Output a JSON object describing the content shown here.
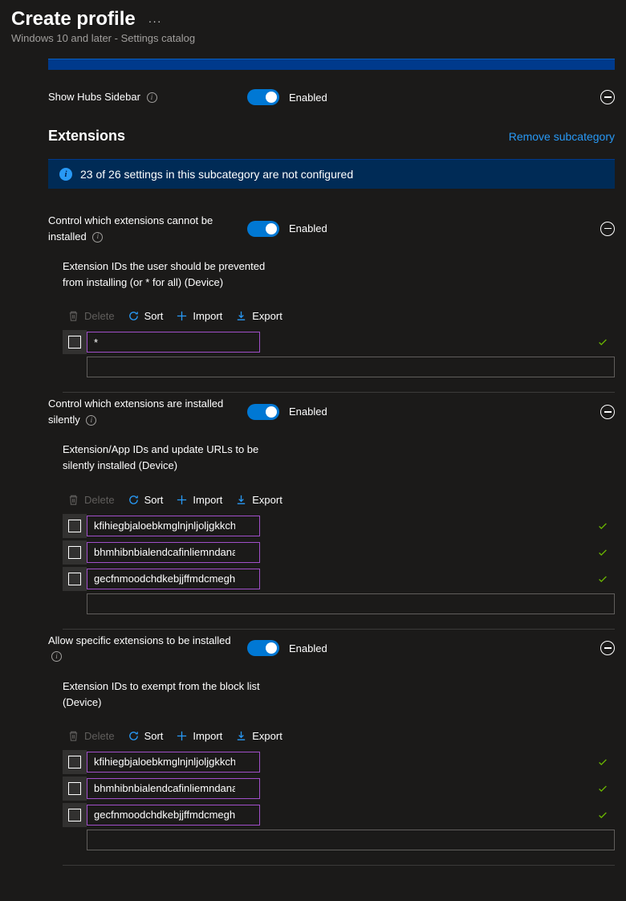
{
  "header": {
    "title": "Create profile",
    "subtitle": "Windows 10 and later - Settings catalog"
  },
  "labels": {
    "enabled": "Enabled",
    "remove_subcategory": "Remove subcategory"
  },
  "actions": {
    "delete": "Delete",
    "sort": "Sort",
    "import": "Import",
    "export": "Export"
  },
  "hubs_setting": {
    "label": "Show Hubs Sidebar"
  },
  "extensions_section": {
    "title": "Extensions",
    "banner": "23 of 26 settings in this subcategory are not configured"
  },
  "blocks": [
    {
      "label": "Control which extensions cannot be installed",
      "sublabel": "Extension IDs the user should be prevented from installing (or * for all) (Device)",
      "items": [
        "*"
      ]
    },
    {
      "label": "Control which extensions are installed silently",
      "sublabel": "Extension/App IDs and update URLs to be silently installed (Device)",
      "items": [
        "kfihiegbjaloebkmglnjnljoljgkkchm",
        "bhmhibnbialendcafinliemndanacfaj",
        "gecfnmoodchdkebjjffmdcmeghkflpib"
      ]
    },
    {
      "label": "Allow specific extensions to be installed",
      "sublabel": "Extension IDs to exempt from the block list (Device)",
      "items": [
        "kfihiegbjaloebkmglnjnljoljgkkchm",
        "bhmhibnbialendcafinliemndanacfaj",
        "gecfnmoodchdkebjjffmdcmeghkflpib"
      ]
    }
  ]
}
